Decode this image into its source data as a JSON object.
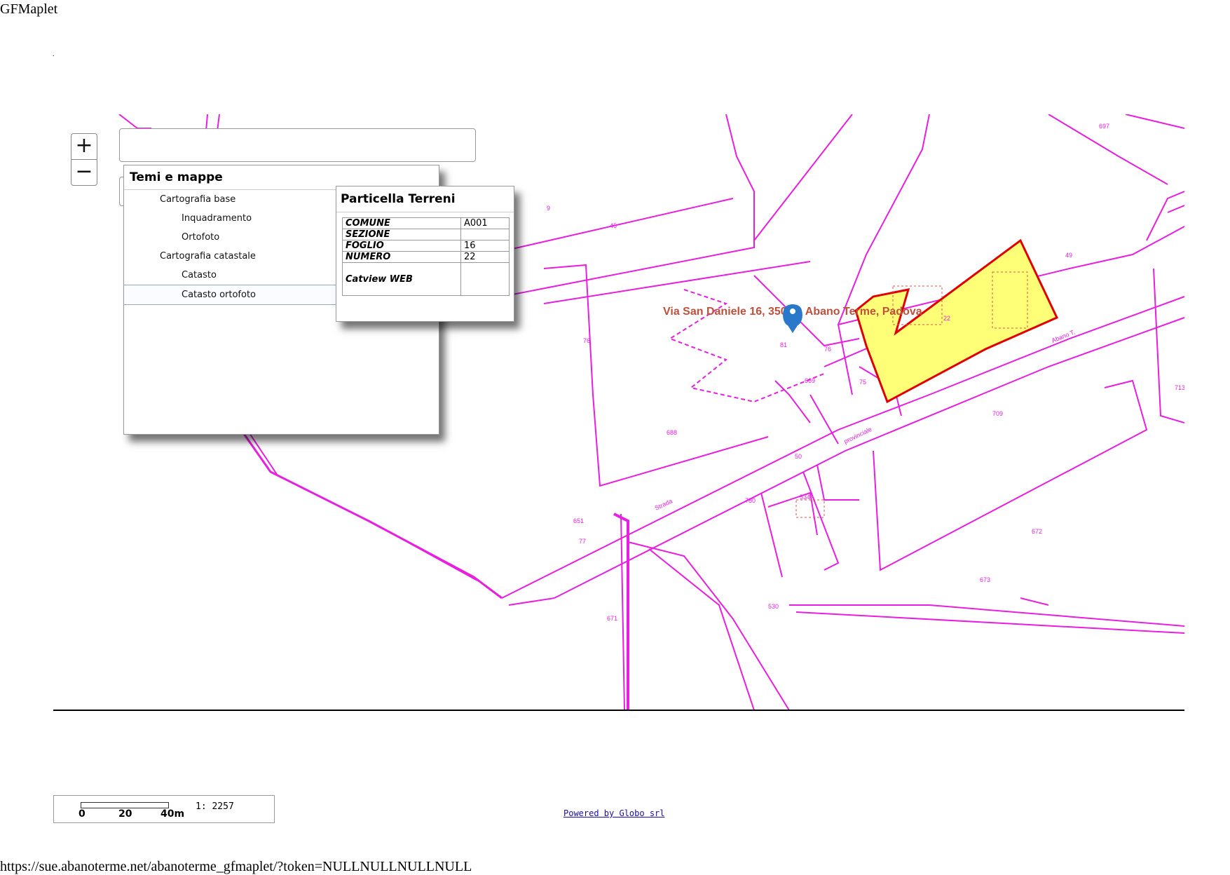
{
  "page": {
    "title": "GFMaplet",
    "dot": ".",
    "url": "https://sue.abanoterme.net/abanoterme_gfmaplet/?token=NULLNULLNULLNULL"
  },
  "map": {
    "zoom_in": "+",
    "zoom_out": "−",
    "address_label": "Via San Daniele 16, 35031, Abano Terme, Padova",
    "parcel_numbers": [
      "697",
      "9",
      "45",
      "49",
      "22",
      "75",
      "76",
      "81",
      "669",
      "709",
      "688",
      "50",
      "534",
      "780",
      "651",
      "77",
      "671",
      "530",
      "673",
      "672",
      "75",
      "713"
    ],
    "road_labels": [
      "Abano T.",
      "provinciale",
      "Strada"
    ],
    "colors": {
      "parcel_lines": "#e81ee0",
      "selected_fill": "#ffff77",
      "selected_border": "#e00000",
      "marker": "#2a78c9"
    }
  },
  "layers_panel": {
    "title": "Temi e mappe",
    "items": [
      {
        "label": "Cartografia base",
        "level": 1
      },
      {
        "label": "Inquadramento",
        "level": 2
      },
      {
        "label": "Ortofoto",
        "level": 2
      },
      {
        "label": "Cartografia catastale",
        "level": 1
      },
      {
        "label": "Catasto",
        "level": 2
      },
      {
        "label": "Catasto ortofoto",
        "level": 2,
        "selected": true
      }
    ]
  },
  "info_popup": {
    "title": "Particella Terreni",
    "rows": [
      {
        "key": "COMUNE",
        "value": "A001"
      },
      {
        "key": "SEZIONE",
        "value": ""
      },
      {
        "key": "FOGLIO",
        "value": "16"
      },
      {
        "key": "NUMERO",
        "value": "22"
      },
      {
        "key": "Catview WEB",
        "value": ""
      }
    ]
  },
  "scale": {
    "labels": [
      "0",
      "20",
      "40m"
    ],
    "ratio": "1: 2257"
  },
  "footer": {
    "powered_by": "Powered by Globo srl"
  }
}
